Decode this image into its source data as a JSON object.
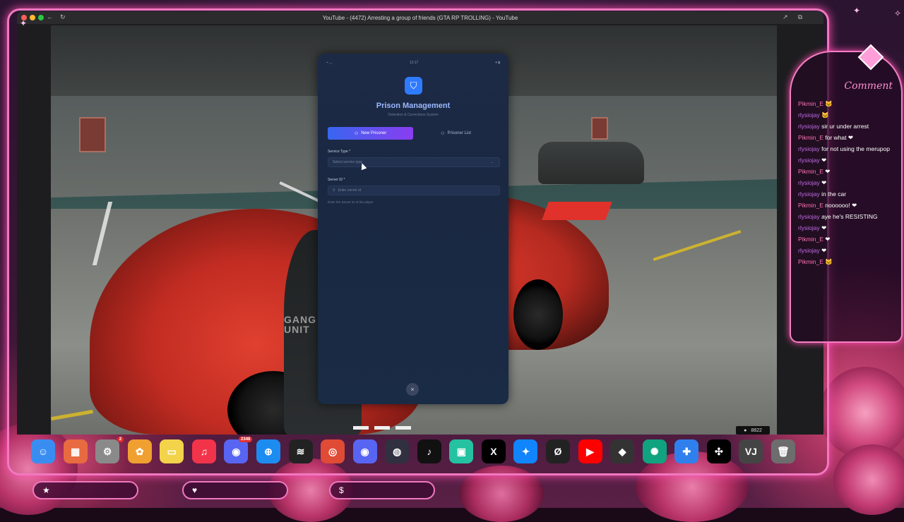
{
  "window": {
    "title": "YouTube - (4472) Arresting a group of friends (GTA RP TROLLING) - YouTube",
    "traffic_lights": [
      "#ff5f57",
      "#febc2e",
      "#28c840"
    ],
    "nav": [
      "←",
      "↻"
    ],
    "right_icons": [
      "↗",
      "⧉"
    ]
  },
  "tablet": {
    "status_time": "12:17",
    "status_right": "▾ ▮",
    "title": "Prison Management",
    "subtitle": "Detention & Corrections System",
    "tabs": [
      {
        "icon": "⚇",
        "label": "New Prisoner",
        "active": true
      },
      {
        "icon": "⚇",
        "label": "Prisoner List",
        "active": false
      }
    ],
    "service_type_label": "Service Type *",
    "service_type_placeholder": "Select service type",
    "server_id_label": "Server ID *",
    "server_id_placeholder": "Enter server id",
    "server_id_hint": "Enter the Server ID of the player",
    "close_glyph": "×"
  },
  "game": {
    "person_text": "GANG UNIT",
    "hud": "8822"
  },
  "dock": {
    "apps": [
      {
        "name": "finder",
        "glyph": "☺",
        "color": "#3a8df0"
      },
      {
        "name": "launchpad",
        "glyph": "▦",
        "color": "#e86a40"
      },
      {
        "name": "system-settings",
        "glyph": "⚙",
        "color": "#8a8a8a",
        "badge": "2"
      },
      {
        "name": "photos",
        "glyph": "✿",
        "color": "#f0a030"
      },
      {
        "name": "notes",
        "glyph": "▭",
        "color": "#f3d34a"
      },
      {
        "name": "music",
        "glyph": "♫",
        "color": "#f2344a"
      },
      {
        "name": "discord-ptb",
        "glyph": "◉",
        "color": "#5865f2",
        "badge": "2348"
      },
      {
        "name": "safari",
        "glyph": "⊕",
        "color": "#1d8cf0"
      },
      {
        "name": "wave",
        "glyph": "≋",
        "color": "#222222"
      },
      {
        "name": "chrome",
        "glyph": "◎",
        "color": "#e04b36"
      },
      {
        "name": "discord",
        "glyph": "◉",
        "color": "#5865f2"
      },
      {
        "name": "obs",
        "glyph": "◍",
        "color": "#303040"
      },
      {
        "name": "tiktok",
        "glyph": "♪",
        "color": "#111111"
      },
      {
        "name": "chatgpt-bot",
        "glyph": "▣",
        "color": "#24c2a0"
      },
      {
        "name": "x",
        "glyph": "X",
        "color": "#000000"
      },
      {
        "name": "bluesky",
        "glyph": "✦",
        "color": "#1185fe"
      },
      {
        "name": "app-o",
        "glyph": "Ø",
        "color": "#222222"
      },
      {
        "name": "youtube",
        "glyph": "▶",
        "color": "#ff0000"
      },
      {
        "name": "roblox",
        "glyph": "◆",
        "color": "#333333"
      },
      {
        "name": "openai",
        "glyph": "✺",
        "color": "#10a37f"
      },
      {
        "name": "plus-app",
        "glyph": "✚",
        "color": "#2f80ed"
      },
      {
        "name": "tidal",
        "glyph": "✣",
        "color": "#000000"
      },
      {
        "name": "vj-app",
        "glyph": "VJ",
        "color": "#444444"
      },
      {
        "name": "trash",
        "glyph": "🗑",
        "color": "#6d6d6d"
      }
    ]
  },
  "chat": {
    "heading": "Comment",
    "messages": [
      {
        "user": "Pikmin_E",
        "type": "a",
        "text": "🐱"
      },
      {
        "user": "rlysiojay",
        "type": "b",
        "text": "🐱"
      },
      {
        "user": "rlysiojay",
        "type": "b",
        "text": "sir ur under arrest"
      },
      {
        "user": "Pikmin_E",
        "type": "a",
        "text": "for what ❤"
      },
      {
        "user": "rlysiojay",
        "type": "b",
        "text": "for not using the merupop"
      },
      {
        "user": "rlysiojay",
        "type": "b",
        "text": "❤"
      },
      {
        "user": "Pikmin_E",
        "type": "a",
        "text": "❤"
      },
      {
        "user": "rlysiojay",
        "type": "b",
        "text": "❤"
      },
      {
        "user": "rlysiojay",
        "type": "b",
        "text": "in the car"
      },
      {
        "user": "Pikmin_E",
        "type": "a",
        "text": "noooooo! ❤"
      },
      {
        "user": "rlysiojay",
        "type": "b",
        "text": "aye he's RESISTING"
      },
      {
        "user": "rlysiojay",
        "type": "b",
        "text": "❤"
      },
      {
        "user": "Pikmin_E",
        "type": "a",
        "text": "❤"
      },
      {
        "user": "rlysiojay",
        "type": "b",
        "text": "❤"
      },
      {
        "user": "Pikmin_E",
        "type": "a",
        "text": "🐱"
      }
    ]
  },
  "pills": [
    {
      "icon": "★"
    },
    {
      "icon": "♥"
    },
    {
      "icon": "$"
    }
  ]
}
